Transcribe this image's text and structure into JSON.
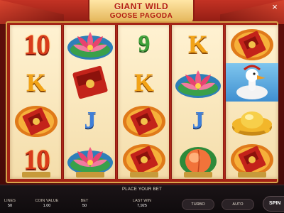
{
  "game": {
    "title_line1": "GIANT WILD",
    "title_line2": "GOOSE PAGODA",
    "close_glyph": "×"
  },
  "reels": [
    [
      "10",
      "K",
      "red-envelope",
      "10"
    ],
    [
      "lotus-flower",
      "red-envelope",
      "J",
      "lotus-flower"
    ],
    [
      "9",
      "K",
      "red-envelope",
      "red-envelope"
    ],
    [
      "K",
      "lotus-flower",
      "J",
      "peach"
    ],
    [
      "red-envelope",
      "goose-wild",
      "gold-ingot",
      "red-envelope"
    ]
  ],
  "status": {
    "message": "PLACE YOUR BET"
  },
  "controls": {
    "lines_label": "LINES",
    "lines_value": "50",
    "coin_value_label": "COIN VALUE",
    "coin_value": "1.00",
    "bet_label": "BET",
    "bet_value": "50",
    "last_win_label": "LAST WIN",
    "last_win_value": "7,925",
    "turbo_label": "TURBO",
    "auto_label": "AUTO",
    "spin_label": "SPIN"
  },
  "colors": {
    "frame_red": "#a32316",
    "reel_cream": "#fff2d2",
    "gold": "#d8a44a",
    "bar_dark": "#1b1417"
  }
}
